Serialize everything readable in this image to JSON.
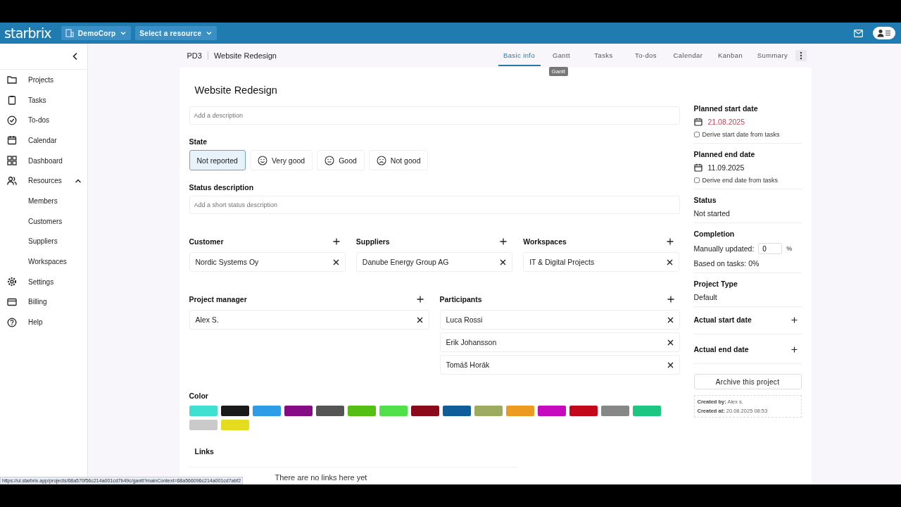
{
  "header": {
    "logo": "starbrix",
    "org": "DemoCorp",
    "resource_select": "Select a resource"
  },
  "sidebar": {
    "items": [
      {
        "label": "Projects"
      },
      {
        "label": "Tasks"
      },
      {
        "label": "To-dos"
      },
      {
        "label": "Calendar"
      },
      {
        "label": "Dashboard"
      },
      {
        "label": "Resources",
        "expanded": true,
        "children": [
          {
            "label": "Members"
          },
          {
            "label": "Customers"
          },
          {
            "label": "Suppliers"
          },
          {
            "label": "Workspaces"
          }
        ]
      },
      {
        "label": "Settings"
      },
      {
        "label": "Billing"
      },
      {
        "label": "Help"
      }
    ]
  },
  "breadcrumb": {
    "code": "PD3",
    "name": "Website Redesign"
  },
  "tabs": [
    {
      "label": "Basic info",
      "selected": true
    },
    {
      "label": "Gantt",
      "selected": false
    },
    {
      "label": "Tasks",
      "selected": false
    },
    {
      "label": "To-dos",
      "selected": false
    },
    {
      "label": "Calendar",
      "selected": false
    },
    {
      "label": "Kanban",
      "selected": false
    },
    {
      "label": "Summary",
      "selected": false
    }
  ],
  "tooltip": "Gantt",
  "project": {
    "title": "Website Redesign",
    "description_placeholder": "Add a description",
    "state_label": "State",
    "states": [
      {
        "label": "Not reported",
        "kind": "plain",
        "selected": true
      },
      {
        "label": "Very good",
        "kind": "happy",
        "selected": false
      },
      {
        "label": "Good",
        "kind": "neutral",
        "selected": false
      },
      {
        "label": "Not good",
        "kind": "sad",
        "selected": false
      }
    ],
    "status_description_label": "Status description",
    "status_description_placeholder": "Add a short status description",
    "pickers": [
      {
        "label": "Customer",
        "items": [
          "Nordic Systems Oy"
        ]
      },
      {
        "label": "Suppliers",
        "items": [
          "Danube Energy Group AG"
        ]
      },
      {
        "label": "Workspaces",
        "items": [
          "IT & Digital Projects"
        ]
      }
    ],
    "people": [
      {
        "label": "Project manager",
        "items": [
          "Alex S."
        ]
      },
      {
        "label": "Participants",
        "items": [
          "Luca Rossi",
          "Erik Johansson",
          "Tomáš Horák"
        ]
      }
    ],
    "color_label": "Color",
    "colors": [
      {
        "color": "#3fdfd2"
      },
      {
        "color": "#1a1a1a"
      },
      {
        "color": "#2f9ce8"
      },
      {
        "color": "#860c86"
      },
      {
        "color": "#555555"
      },
      {
        "color": "#55bf14"
      },
      {
        "color": "#52e04a"
      },
      {
        "color": "#8a0a1c"
      },
      {
        "color": "#0f5e9a"
      },
      {
        "color": "#9dab60"
      },
      {
        "color": "#ec9a20"
      },
      {
        "color": "#c60bbf"
      },
      {
        "color": "#c4081b"
      },
      {
        "color": "#878787"
      },
      {
        "color": "#1ec684"
      },
      {
        "color": "#cacaca"
      },
      {
        "color": "#e5db1f"
      }
    ],
    "links_label": "Links",
    "links_empty": "There are no links here yet"
  },
  "details": {
    "start_label": "Planned start date",
    "start_date": "21.08.2025",
    "start_overdue": true,
    "derive_start": {
      "label": "Derive start date from tasks",
      "checked": false
    },
    "end_label": "Planned end date",
    "end_date": "11.09.2025",
    "end_overdue": false,
    "derive_end": {
      "label": "Derive end date from tasks",
      "checked": false
    },
    "status_label": "Status",
    "status": "Not started",
    "completion_label": "Completion",
    "manual_label": "Manually updated:",
    "manual_value": "0",
    "percent": "%",
    "based_on_tasks": "Based on tasks: 0%",
    "type_label": "Project Type",
    "type": "Default",
    "actual_start_label": "Actual start date",
    "actual_end_label": "Actual end date",
    "archive": "Archive this project",
    "created_by_label": "Created by:",
    "created_by": "Alex s.",
    "created_at_label": "Created at:",
    "created_at": "20.08.2025 08:53"
  },
  "status_url": "https://ui.starbrix.app/projects/68a570f56c214a001cd7b49c/gantt?mainContext=68a566096c214a001cd7abf2"
}
